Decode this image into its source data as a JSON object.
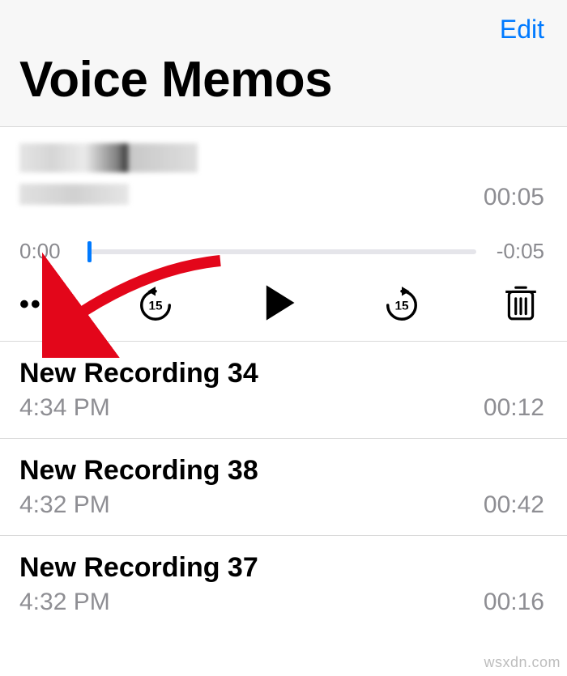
{
  "header": {
    "edit_label": "Edit",
    "title": "Voice Memos"
  },
  "selected": {
    "total_duration": "00:05",
    "elapsed": "0:00",
    "remaining": "-0:05"
  },
  "recordings": [
    {
      "title": "New Recording 34",
      "time": "4:34 PM",
      "duration": "00:12"
    },
    {
      "title": "New Recording 38",
      "time": "4:32 PM",
      "duration": "00:42"
    },
    {
      "title": "New Recording 37",
      "time": "4:32 PM",
      "duration": "00:16"
    }
  ],
  "watermark": "wsxdn.com"
}
